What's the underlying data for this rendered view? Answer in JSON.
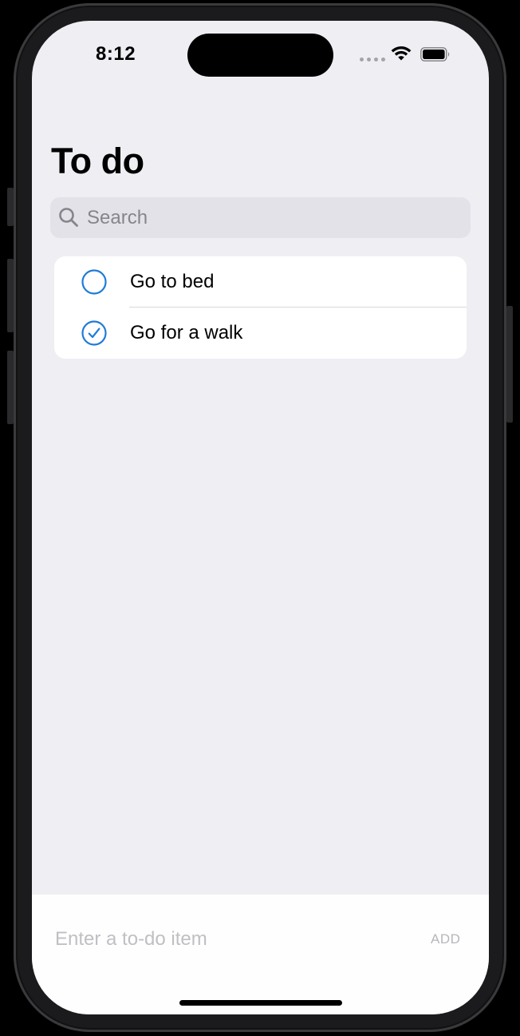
{
  "status_bar": {
    "time": "8:12",
    "icons": [
      "cellular-dots-icon",
      "wifi-icon",
      "battery-icon"
    ]
  },
  "header": {
    "title": "To do"
  },
  "search": {
    "placeholder": "Search",
    "value": "",
    "icon": "search-icon"
  },
  "todo_list": {
    "items": [
      {
        "label": "Go to bed",
        "completed": false,
        "icon": "empty-circle-icon"
      },
      {
        "label": "Go for a walk",
        "completed": true,
        "icon": "checkmark-circle-icon"
      }
    ]
  },
  "composer": {
    "input_placeholder": "Enter a to-do item",
    "input_value": "",
    "add_label": "ADD"
  },
  "colors": {
    "accent": "#1f7bd6",
    "background": "#efeef3",
    "card": "#ffffff",
    "search_fill": "#e3e2e8",
    "placeholder": "#86858c",
    "add_disabled": "#b7b6bc"
  }
}
